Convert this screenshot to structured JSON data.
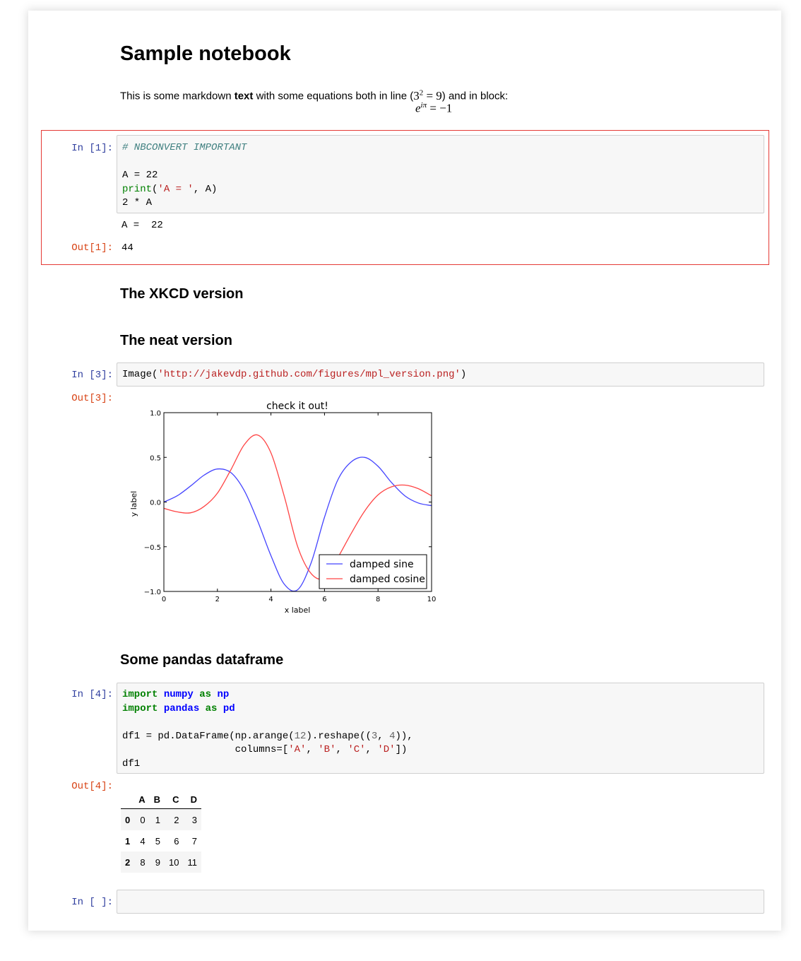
{
  "notebook": {
    "title": "Sample notebook",
    "intro": {
      "before_bold": "This is some markdown ",
      "bold": "text",
      "after_bold": " with some equations both in line (",
      "inline_math_base": "3",
      "inline_math_exp": "2",
      "inline_math_rest": " = 9",
      "after_math": ") and in block:",
      "block_math_base": "e",
      "block_math_exp": "iπ",
      "block_math_rest": " = −1"
    },
    "headings": {
      "xkcd": "The XKCD version",
      "neat": "The neat version",
      "pandas": "Some pandas dataframe"
    }
  },
  "cells": {
    "cell1": {
      "prompt_in": "In [1]:",
      "prompt_out": "Out[1]:",
      "comment": "# NBCONVERT IMPORTANT",
      "line_assign": "A = 22",
      "print_fn": "print",
      "print_open": "(",
      "print_str": "'A = '",
      "print_rest": ", A)",
      "line_mult": "2 * A",
      "stdout": "A =  22",
      "result": "44"
    },
    "cell3": {
      "prompt_in": "In [3]:",
      "prompt_out": "Out[3]:",
      "fn": "Image(",
      "url": "'http://jakevdp.github.com/figures/mpl_version.png'",
      "close": ")"
    },
    "cell4": {
      "prompt_in": "In [4]:",
      "prompt_out": "Out[4]:",
      "kw_import": "import",
      "kw_as": "as",
      "mod1": "numpy",
      "alias1": "np",
      "mod2": "pandas",
      "alias2": "pd",
      "line3_a": "df1 = pd.DataFrame(np.arange(",
      "line3_num1": "12",
      "line3_b": ").reshape((",
      "line3_num2": "3",
      "line3_c": ", ",
      "line3_num3": "4",
      "line3_d": ")),",
      "line4_a": "                   columns=[",
      "col_a": "'A'",
      "col_b": "'B'",
      "col_c": "'C'",
      "col_d": "'D'",
      "line4_end": "])",
      "line5": "df1",
      "sep": ", "
    },
    "cell_empty": {
      "prompt_in": "In [ ]:"
    }
  },
  "dataframe": {
    "columns": [
      "A",
      "B",
      "C",
      "D"
    ],
    "rows": [
      {
        "index": "0",
        "values": [
          "0",
          "1",
          "2",
          "3"
        ]
      },
      {
        "index": "1",
        "values": [
          "4",
          "5",
          "6",
          "7"
        ]
      },
      {
        "index": "2",
        "values": [
          "8",
          "9",
          "10",
          "11"
        ]
      }
    ]
  },
  "chart_data": {
    "type": "line",
    "title": "check it out!",
    "xlabel": "x label",
    "ylabel": "y label",
    "xlim": [
      0,
      10
    ],
    "ylim": [
      -1.0,
      1.0
    ],
    "xticks": [
      "0",
      "2",
      "4",
      "6",
      "8",
      "10"
    ],
    "yticks": [
      "1.0",
      "0.5",
      "0.0",
      "−0.5",
      "−1.0"
    ],
    "legend_position": "lower-right",
    "series": [
      {
        "name": "damped sine",
        "color": "#4444ff",
        "x": [
          0,
          0.5,
          1.0,
          1.5,
          2.0,
          2.5,
          3.0,
          3.5,
          4.0,
          4.5,
          5.0,
          5.5,
          6.0,
          6.5,
          7.0,
          7.5,
          8.0,
          8.5,
          9.0,
          9.5,
          10.0
        ],
        "y": [
          0.0,
          0.07,
          0.18,
          0.3,
          0.37,
          0.33,
          0.13,
          -0.21,
          -0.6,
          -0.92,
          -0.98,
          -0.68,
          -0.17,
          0.25,
          0.45,
          0.5,
          0.4,
          0.22,
          0.07,
          -0.01,
          -0.04
        ]
      },
      {
        "name": "damped cosine",
        "color": "#ff4444",
        "x": [
          0,
          0.5,
          1.0,
          1.5,
          2.0,
          2.5,
          3.0,
          3.5,
          4.0,
          4.5,
          5.0,
          5.5,
          6.0,
          6.5,
          7.0,
          7.5,
          8.0,
          8.5,
          9.0,
          9.5,
          10.0
        ],
        "y": [
          -0.07,
          -0.11,
          -0.12,
          -0.05,
          0.1,
          0.36,
          0.64,
          0.75,
          0.55,
          0.06,
          -0.5,
          -0.8,
          -0.85,
          -0.62,
          -0.35,
          -0.1,
          0.08,
          0.17,
          0.19,
          0.15,
          0.07
        ]
      }
    ]
  }
}
